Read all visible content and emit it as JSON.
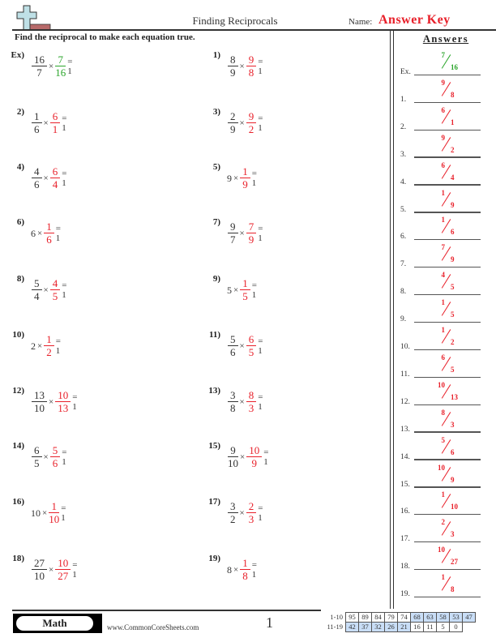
{
  "header": {
    "title": "Finding Reciprocals",
    "name_label": "Name:",
    "name_value": "Answer Key",
    "instructions": "Find the reciprocal to make each equation true."
  },
  "colors": {
    "answer": "#e8202a",
    "example": "#2aa52a",
    "score_highlight": "#c9def7"
  },
  "problems": [
    {
      "label": "Ex)",
      "left": {
        "num": "16",
        "den": "7"
      },
      "answer": {
        "num": "7",
        "den": "16"
      },
      "times": "×",
      "equals": "= 1",
      "example": true
    },
    {
      "label": "1)",
      "left": {
        "num": "8",
        "den": "9"
      },
      "answer": {
        "num": "9",
        "den": "8"
      },
      "times": "×",
      "equals": "= 1"
    },
    {
      "label": "2)",
      "left": {
        "num": "1",
        "den": "6"
      },
      "answer": {
        "num": "6",
        "den": "1"
      },
      "times": "×",
      "equals": "= 1"
    },
    {
      "label": "3)",
      "left": {
        "num": "2",
        "den": "9"
      },
      "answer": {
        "num": "9",
        "den": "2"
      },
      "times": "×",
      "equals": "= 1"
    },
    {
      "label": "4)",
      "left": {
        "num": "4",
        "den": "6"
      },
      "answer": {
        "num": "6",
        "den": "4"
      },
      "times": "×",
      "equals": "= 1"
    },
    {
      "label": "5)",
      "left": {
        "whole": "9"
      },
      "answer": {
        "num": "1",
        "den": "9"
      },
      "times": "×",
      "equals": "= 1"
    },
    {
      "label": "6)",
      "left": {
        "whole": "6"
      },
      "answer": {
        "num": "1",
        "den": "6"
      },
      "times": "×",
      "equals": "= 1"
    },
    {
      "label": "7)",
      "left": {
        "num": "9",
        "den": "7"
      },
      "answer": {
        "num": "7",
        "den": "9"
      },
      "times": "×",
      "equals": "= 1"
    },
    {
      "label": "8)",
      "left": {
        "num": "5",
        "den": "4"
      },
      "answer": {
        "num": "4",
        "den": "5"
      },
      "times": "×",
      "equals": "= 1"
    },
    {
      "label": "9)",
      "left": {
        "whole": "5"
      },
      "answer": {
        "num": "1",
        "den": "5"
      },
      "times": "×",
      "equals": "= 1"
    },
    {
      "label": "10)",
      "left": {
        "whole": "2"
      },
      "answer": {
        "num": "1",
        "den": "2"
      },
      "times": "×",
      "equals": "= 1"
    },
    {
      "label": "11)",
      "left": {
        "num": "5",
        "den": "6"
      },
      "answer": {
        "num": "6",
        "den": "5"
      },
      "times": "×",
      "equals": "= 1"
    },
    {
      "label": "12)",
      "left": {
        "num": "13",
        "den": "10"
      },
      "answer": {
        "num": "10",
        "den": "13"
      },
      "times": "×",
      "equals": "= 1"
    },
    {
      "label": "13)",
      "left": {
        "num": "3",
        "den": "8"
      },
      "answer": {
        "num": "8",
        "den": "3"
      },
      "times": "×",
      "equals": "= 1"
    },
    {
      "label": "14)",
      "left": {
        "num": "6",
        "den": "5"
      },
      "answer": {
        "num": "5",
        "den": "6"
      },
      "times": "×",
      "equals": "= 1"
    },
    {
      "label": "15)",
      "left": {
        "num": "9",
        "den": "10"
      },
      "answer": {
        "num": "10",
        "den": "9"
      },
      "times": "×",
      "equals": "= 1"
    },
    {
      "label": "16)",
      "left": {
        "whole": "10"
      },
      "answer": {
        "num": "1",
        "den": "10"
      },
      "times": "×",
      "equals": "= 1"
    },
    {
      "label": "17)",
      "left": {
        "num": "3",
        "den": "2"
      },
      "answer": {
        "num": "2",
        "den": "3"
      },
      "times": "×",
      "equals": "= 1"
    },
    {
      "label": "18)",
      "left": {
        "num": "27",
        "den": "10"
      },
      "answer": {
        "num": "10",
        "den": "27"
      },
      "times": "×",
      "equals": "= 1"
    },
    {
      "label": "19)",
      "left": {
        "whole": "8"
      },
      "answer": {
        "num": "1",
        "den": "8"
      },
      "times": "×",
      "equals": "= 1"
    }
  ],
  "answers_panel": {
    "title": "Answers",
    "items": [
      {
        "label": "Ex.",
        "num": "7",
        "den": "16",
        "example": true
      },
      {
        "label": "1.",
        "num": "9",
        "den": "8"
      },
      {
        "label": "2.",
        "num": "6",
        "den": "1"
      },
      {
        "label": "3.",
        "num": "9",
        "den": "2"
      },
      {
        "label": "4.",
        "num": "6",
        "den": "4"
      },
      {
        "label": "5.",
        "num": "1",
        "den": "9"
      },
      {
        "label": "6.",
        "num": "1",
        "den": "6"
      },
      {
        "label": "7.",
        "num": "7",
        "den": "9"
      },
      {
        "label": "8.",
        "num": "4",
        "den": "5"
      },
      {
        "label": "9.",
        "num": "1",
        "den": "5"
      },
      {
        "label": "10.",
        "num": "1",
        "den": "2"
      },
      {
        "label": "11.",
        "num": "6",
        "den": "5"
      },
      {
        "label": "12.",
        "num": "10",
        "den": "13"
      },
      {
        "label": "13.",
        "num": "8",
        "den": "3"
      },
      {
        "label": "14.",
        "num": "5",
        "den": "6"
      },
      {
        "label": "15.",
        "num": "10",
        "den": "9"
      },
      {
        "label": "16.",
        "num": "1",
        "den": "10"
      },
      {
        "label": "17.",
        "num": "2",
        "den": "3"
      },
      {
        "label": "18.",
        "num": "10",
        "den": "27"
      },
      {
        "label": "19.",
        "num": "1",
        "den": "8"
      }
    ]
  },
  "footer": {
    "subject": "Math",
    "site": "www.CommonCoreSheets.com",
    "page": "1",
    "score_rows": [
      {
        "label": "1-10",
        "scores": [
          "95",
          "89",
          "84",
          "79",
          "74",
          "68",
          "63",
          "58",
          "53",
          "47"
        ],
        "highlight_from": 5
      },
      {
        "label": "11-19",
        "scores": [
          "42",
          "37",
          "32",
          "26",
          "21",
          "16",
          "11",
          "5",
          "0"
        ],
        "highlight_to": 4
      }
    ]
  }
}
